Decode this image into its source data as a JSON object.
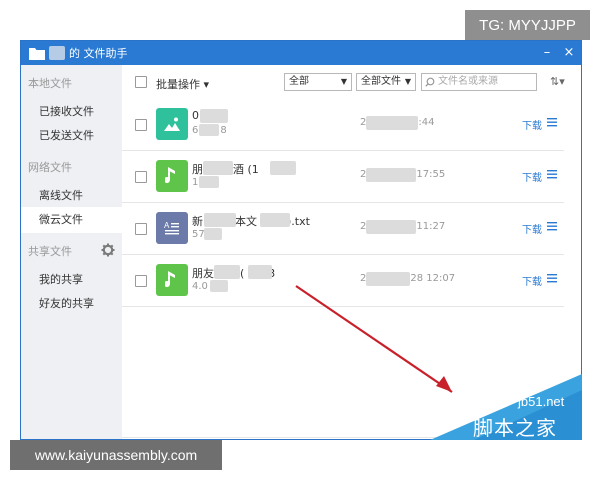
{
  "tg_badge": "TG: MYYJJPP",
  "window": {
    "title": "的 文件助手",
    "minimize": "–",
    "close": "×"
  },
  "sidebar": {
    "local_title": "本地文件",
    "local_items": [
      "已接收文件",
      "已发送文件"
    ],
    "network_title": "网络文件",
    "network_items": [
      "离线文件",
      "微云文件"
    ],
    "shared_title": "共享文件",
    "shared_items": [
      "我的共享",
      "好友的共享"
    ]
  },
  "toolbar": {
    "batch_label": "批量操作",
    "filter_all": "全部",
    "filter_files": "全部文件",
    "search_placeholder": "文件名或来源"
  },
  "files": [
    {
      "name": "0",
      "size": "6",
      "size_tail": "8",
      "time_prefix": "2",
      "time": ":44",
      "action": "下载",
      "icon": "image-icon",
      "color": "#2fc09c"
    },
    {
      "name": "朋",
      "name_tail": "酒 (1",
      "name_end": "3",
      "size": "1",
      "time_prefix": "2",
      "time": "17:55",
      "action": "下载",
      "icon": "music-icon",
      "color": "#5fc44a"
    },
    {
      "name": "新",
      "name_mid": "本文",
      "name_end": ").txt",
      "size": "57",
      "time_prefix": "2",
      "time": "11:27",
      "action": "下载",
      "icon": "text-icon",
      "color": "#6b7aa8"
    },
    {
      "name": "朋友",
      "name_tail": "(",
      "name_end": "3",
      "size": "4.0",
      "time_prefix": "2",
      "time": "28 12:07",
      "action": "下载",
      "icon": "music-icon",
      "color": "#5fc44a"
    }
  ],
  "watermark": {
    "site": "www.kaiyunassembly.com",
    "corner_url": "jb51.net",
    "corner_cn": "脚本之家"
  }
}
